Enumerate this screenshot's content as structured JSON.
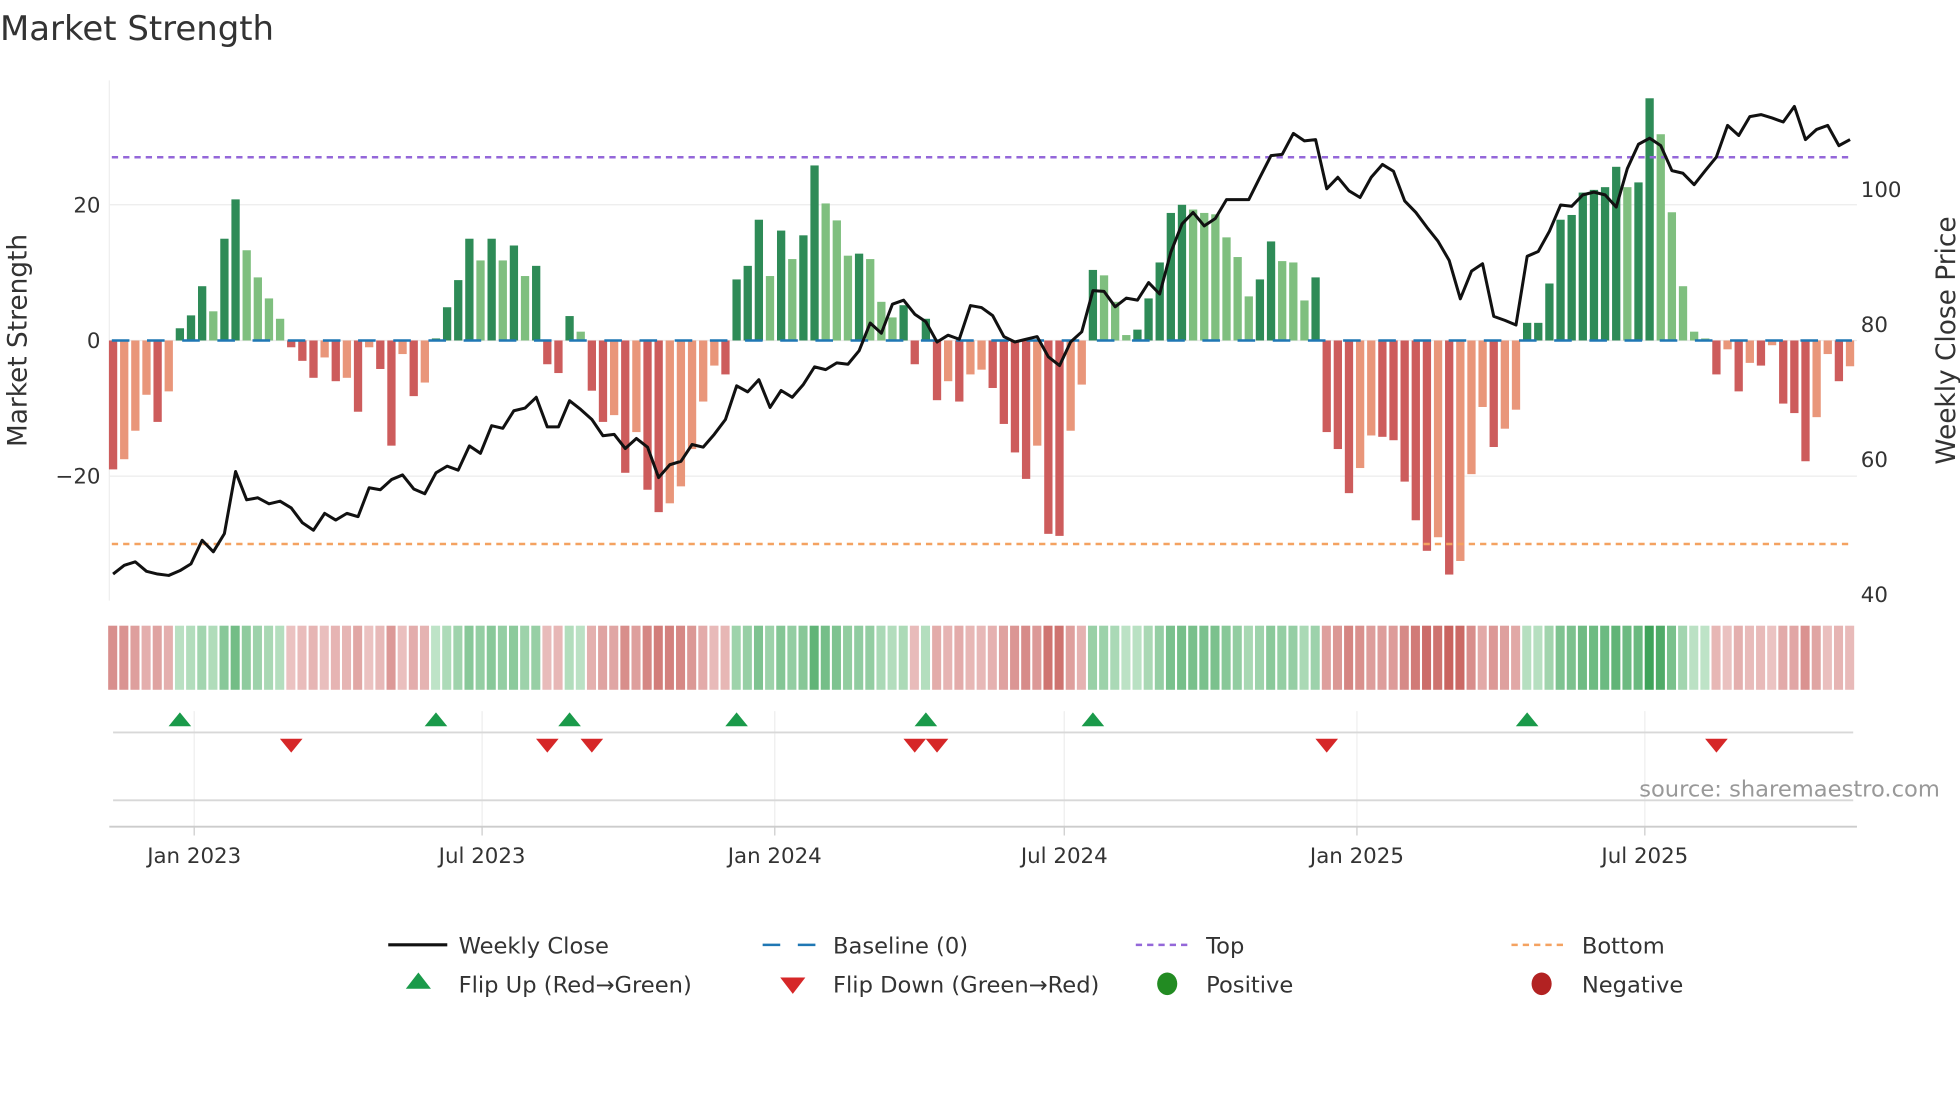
{
  "chart_data": {
    "type": "bar",
    "title": "Market Strength",
    "ylabel": "Market Strength",
    "y2label": "Weekly Close Price",
    "ylim": [
      -38,
      38.5
    ],
    "y2lim": [
      40,
      116
    ],
    "yticks": [
      {
        "v": 20,
        "label": "20"
      },
      {
        "v": 0,
        "label": "0"
      },
      {
        "v": -20,
        "label": "−20"
      }
    ],
    "y2ticks": [
      {
        "v": 100,
        "label": "100"
      },
      {
        "v": 80,
        "label": "80"
      },
      {
        "v": 60,
        "label": "60"
      },
      {
        "v": 40,
        "label": "40"
      }
    ],
    "xticks": [
      {
        "date": "2023-01-01",
        "label": "Jan 2023"
      },
      {
        "date": "2023-07-01",
        "label": "Jul 2023"
      },
      {
        "date": "2024-01-01",
        "label": "Jan 2024"
      },
      {
        "date": "2024-07-01",
        "label": "Jul 2024"
      },
      {
        "date": "2025-01-01",
        "label": "Jan 2025"
      },
      {
        "date": "2025-07-01",
        "label": "Jul 2025"
      }
    ],
    "start_week": "2022-11-11",
    "frequency": "weekly",
    "top_level": 27,
    "bottom_level": -30,
    "baseline": 0,
    "grid": true,
    "legend_position": "bottom",
    "source": "source: sharemaestro.com",
    "strength": [
      -19,
      -17.5,
      -13.3,
      -8,
      -12,
      -7.5,
      1.8,
      3.7,
      8,
      4.3,
      15,
      20.8,
      13.3,
      9.3,
      6.2,
      3.2,
      -1,
      -3,
      -5.5,
      -2.5,
      -6,
      -5.5,
      -10.5,
      -1,
      -4.2,
      -15.5,
      -2,
      -8.2,
      -6.2,
      0.3,
      4.9,
      8.9,
      15,
      11.8,
      15,
      11.8,
      14,
      9.5,
      11,
      -3.5,
      -4.8,
      3.6,
      1.3,
      -7.4,
      -12,
      -11,
      -19.5,
      -13.5,
      -22,
      -25.3,
      -24,
      -21.5,
      -16,
      -9,
      -3.7,
      -5,
      9,
      11,
      17.8,
      9.5,
      16.2,
      12,
      15.5,
      25.8,
      20.2,
      17.7,
      12.5,
      12.8,
      12,
      5.7,
      3.4,
      5.2,
      -3.5,
      3.2,
      -8.8,
      -6,
      -9,
      -5,
      -4.3,
      -7,
      -12.3,
      -16.5,
      -20.4,
      -15.5,
      -28.5,
      -28.8,
      -13.3,
      -6.5,
      10.4,
      9.6,
      5.7,
      0.8,
      1.6,
      6.2,
      11.5,
      18.8,
      20,
      19.3,
      18.8,
      18.6,
      15.2,
      12.3,
      6.5,
      9,
      14.6,
      11.7,
      11.5,
      5.9,
      9.3,
      -13.5,
      -16,
      -22.5,
      -18.8,
      -14,
      -14.2,
      -14.7,
      -20.8,
      -26.5,
      -31,
      -29,
      -34.5,
      -32.5,
      -19.7,
      -9.8,
      -15.7,
      -13,
      -10.2,
      2.6,
      2.6,
      8.4,
      17.8,
      18.5,
      21.8,
      22.2,
      22.6,
      25.6,
      22.6,
      23.3,
      35.7,
      30.4,
      18.9,
      8,
      1.3,
      0.3,
      -5,
      -1.3,
      -7.5,
      -3.3,
      -3.7,
      -0.7,
      -9.3,
      -10.7,
      -17.8,
      -11.3,
      -2,
      -6,
      -3.8
    ],
    "close": [
      43,
      44.3,
      44.8,
      43.4,
      43,
      42.8,
      43.5,
      44.5,
      48,
      46.3,
      49,
      58.2,
      54,
      54.3,
      53.4,
      53.8,
      52.8,
      50.6,
      49.5,
      52,
      51,
      52,
      51.5,
      55.8,
      55.5,
      57,
      57.7,
      55.6,
      54.9,
      58,
      59,
      58.4,
      62,
      60.9,
      65,
      64.6,
      67.2,
      67.6,
      69.2,
      64.8,
      64.8,
      68.7,
      67.4,
      65.9,
      63.5,
      63.7,
      61.6,
      63.1,
      61.8,
      57.3,
      59.2,
      59.7,
      62.2,
      61.8,
      63.7,
      65.9,
      70.9,
      70,
      71.8,
      67.7,
      70.2,
      69.2,
      71.1,
      73.7,
      73.3,
      74.3,
      74.1,
      76.1,
      80.2,
      78.7,
      83,
      83.6,
      81.5,
      80.4,
      77.4,
      78.4,
      77.8,
      82.8,
      82.5,
      81.3,
      78.2,
      77.4,
      77.8,
      78.2,
      75.2,
      73.9,
      77.4,
      78.9,
      85,
      84.9,
      82.6,
      83.9,
      83.6,
      86.2,
      84.5,
      90.7,
      94.9,
      96.6,
      94.6,
      95.7,
      98.5,
      98.5,
      98.5,
      101.8,
      105,
      105.2,
      108.3,
      107.2,
      107.4,
      100.1,
      101.8,
      99.8,
      98.8,
      101.8,
      103.7,
      102.7,
      98.3,
      96.6,
      94.4,
      92.3,
      89.5,
      83.8,
      87.9,
      89,
      81.2,
      80.6,
      79.9,
      90.1,
      90.8,
      93.8,
      97.7,
      97.5,
      99.2,
      99.6,
      99.2,
      97.4,
      103.1,
      106.7,
      107.6,
      106.5,
      102.8,
      102.4,
      100.7,
      102.8,
      104.8,
      109.5,
      108,
      110.8,
      111.1,
      110.6,
      110,
      112.3,
      107.4,
      108.9,
      109.5,
      106.5,
      107.4
    ],
    "legend": [
      {
        "key": "close",
        "label": "Weekly Close"
      },
      {
        "key": "baseline",
        "label": "Baseline (0)"
      },
      {
        "key": "top",
        "label": "Top"
      },
      {
        "key": "bottom",
        "label": "Bottom"
      },
      {
        "key": "flip_up",
        "label": "Flip Up (Red→Green)"
      },
      {
        "key": "flip_down",
        "label": "Flip Down (Green→Red)"
      },
      {
        "key": "positive",
        "label": "Positive"
      },
      {
        "key": "negative",
        "label": "Negative"
      }
    ],
    "colors": {
      "pos_rising": "#2e8b57",
      "pos_falling": "#7fbf7f",
      "neg_falling": "#cd5c5c",
      "neg_rising": "#e9967a",
      "close": "#111111",
      "baseline": "#1f77b4",
      "top": "#9467d9",
      "bottom": "#f4a261",
      "flip_up": "#1a9a4a",
      "flip_down": "#d62728",
      "positive": "#228b22",
      "negative": "#b22222",
      "heat_pos": "#3fa35a",
      "heat_neg": "#c8625e"
    }
  }
}
